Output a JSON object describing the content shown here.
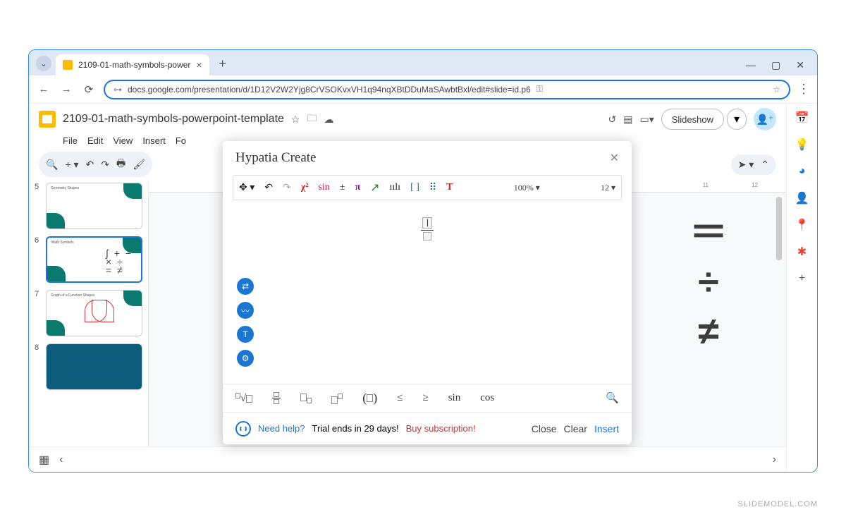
{
  "browser": {
    "tab_title": "2109-01-math-symbols-power",
    "url": "docs.google.com/presentation/d/1D12V2W2Yjg8CrVSOKvxVH1q94nqXBtDDuMaSAwbtBxl/edit#slide=id.p6"
  },
  "app": {
    "doc_title": "2109-01-math-symbols-powerpoint-template",
    "menus": [
      "File",
      "Edit",
      "View",
      "Insert",
      "Fo"
    ],
    "slideshow_label": "Slideshow"
  },
  "thumbs": [
    {
      "num": "5",
      "title": "Geometry Shapes"
    },
    {
      "num": "6",
      "title": "Math Symbols"
    },
    {
      "num": "7",
      "title": "Graph of a Function Shapes"
    },
    {
      "num": "8",
      "title": ""
    }
  ],
  "ruler": {
    "right1": "11",
    "right2": "12"
  },
  "modal": {
    "title": "Hypatia Create",
    "tb": {
      "x2": "χ²",
      "sin": "sin",
      "pm": "±",
      "pi": "π",
      "arrow": "↗",
      "bars": "ıılı",
      "brackets": "[ ]",
      "grid": "⠿",
      "T": "T",
      "zoom": "100% ▾",
      "font": "12 ▾"
    },
    "row2": {
      "le": "≤",
      "ge": "≥",
      "sin": "sin",
      "cos": "cos"
    },
    "footer": {
      "need_help": "Need help?",
      "trial": "Trial ends in 29 days!",
      "buy": "Buy subscription!",
      "close": "Close",
      "clear": "Clear",
      "insert": "Insert"
    }
  },
  "slide_symbols": {
    "eq": "＝",
    "div": "÷",
    "neq": "≠"
  },
  "watermark": "SLIDEMODEL.COM"
}
